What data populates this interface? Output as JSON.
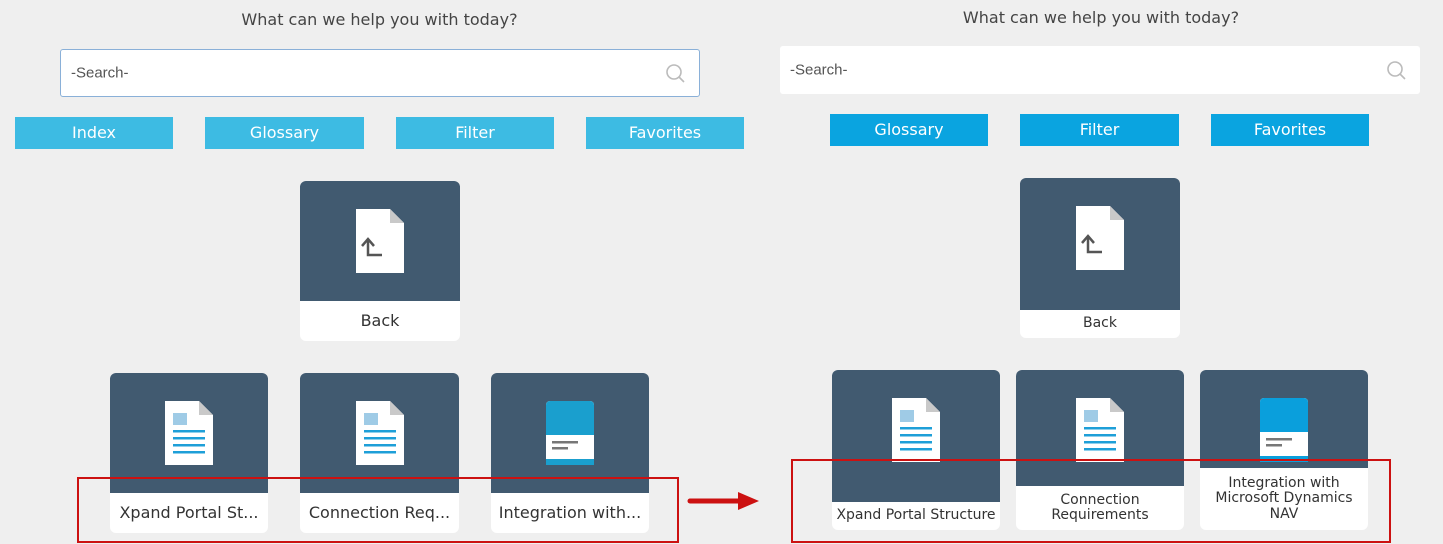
{
  "left": {
    "heading": "What can we help you with today?",
    "search_placeholder": "-Search-",
    "buttons": [
      "Index",
      "Glossary",
      "Filter",
      "Favorites"
    ],
    "back_label": "Back",
    "tiles": [
      "Xpand Portal St...",
      "Connection Req...",
      "Integration with..."
    ]
  },
  "right": {
    "heading": "What can we help you with today?",
    "search_placeholder": "-Search-",
    "buttons": [
      "Glossary",
      "Filter",
      "Favorites"
    ],
    "back_label": "Back",
    "tiles": [
      "Xpand Portal Structure",
      "Connection Requirements",
      "Integration with Microsoft Dynamics NAV"
    ]
  },
  "colors": {
    "tile_header": "#415a70",
    "left_button": "#3dbbe3",
    "right_button": "#0aa4e0",
    "highlight": "#cc1111",
    "arrow": "#cc1111"
  },
  "icons": {
    "search": "search-icon",
    "back": "back-document-icon",
    "document": "document-icon",
    "book": "book-icon",
    "arrow": "right-arrow-icon"
  }
}
